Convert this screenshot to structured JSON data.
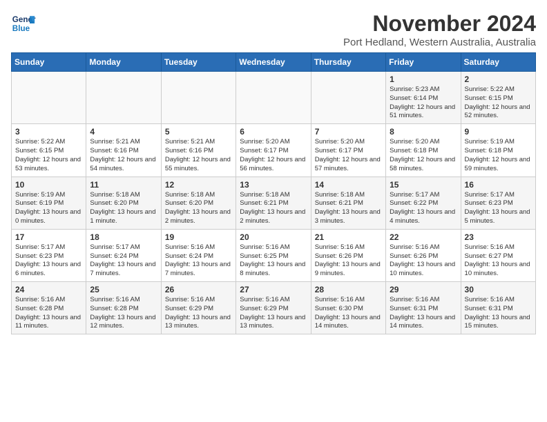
{
  "logo": {
    "line1": "General",
    "line2": "Blue"
  },
  "title": "November 2024",
  "subtitle": "Port Hedland, Western Australia, Australia",
  "days_of_week": [
    "Sunday",
    "Monday",
    "Tuesday",
    "Wednesday",
    "Thursday",
    "Friday",
    "Saturday"
  ],
  "weeks": [
    [
      {
        "day": "",
        "info": ""
      },
      {
        "day": "",
        "info": ""
      },
      {
        "day": "",
        "info": ""
      },
      {
        "day": "",
        "info": ""
      },
      {
        "day": "",
        "info": ""
      },
      {
        "day": "1",
        "info": "Sunrise: 5:23 AM\nSunset: 6:14 PM\nDaylight: 12 hours and 51 minutes."
      },
      {
        "day": "2",
        "info": "Sunrise: 5:22 AM\nSunset: 6:15 PM\nDaylight: 12 hours and 52 minutes."
      }
    ],
    [
      {
        "day": "3",
        "info": "Sunrise: 5:22 AM\nSunset: 6:15 PM\nDaylight: 12 hours and 53 minutes."
      },
      {
        "day": "4",
        "info": "Sunrise: 5:21 AM\nSunset: 6:16 PM\nDaylight: 12 hours and 54 minutes."
      },
      {
        "day": "5",
        "info": "Sunrise: 5:21 AM\nSunset: 6:16 PM\nDaylight: 12 hours and 55 minutes."
      },
      {
        "day": "6",
        "info": "Sunrise: 5:20 AM\nSunset: 6:17 PM\nDaylight: 12 hours and 56 minutes."
      },
      {
        "day": "7",
        "info": "Sunrise: 5:20 AM\nSunset: 6:17 PM\nDaylight: 12 hours and 57 minutes."
      },
      {
        "day": "8",
        "info": "Sunrise: 5:20 AM\nSunset: 6:18 PM\nDaylight: 12 hours and 58 minutes."
      },
      {
        "day": "9",
        "info": "Sunrise: 5:19 AM\nSunset: 6:18 PM\nDaylight: 12 hours and 59 minutes."
      }
    ],
    [
      {
        "day": "10",
        "info": "Sunrise: 5:19 AM\nSunset: 6:19 PM\nDaylight: 13 hours and 0 minutes."
      },
      {
        "day": "11",
        "info": "Sunrise: 5:18 AM\nSunset: 6:20 PM\nDaylight: 13 hours and 1 minute."
      },
      {
        "day": "12",
        "info": "Sunrise: 5:18 AM\nSunset: 6:20 PM\nDaylight: 13 hours and 2 minutes."
      },
      {
        "day": "13",
        "info": "Sunrise: 5:18 AM\nSunset: 6:21 PM\nDaylight: 13 hours and 2 minutes."
      },
      {
        "day": "14",
        "info": "Sunrise: 5:18 AM\nSunset: 6:21 PM\nDaylight: 13 hours and 3 minutes."
      },
      {
        "day": "15",
        "info": "Sunrise: 5:17 AM\nSunset: 6:22 PM\nDaylight: 13 hours and 4 minutes."
      },
      {
        "day": "16",
        "info": "Sunrise: 5:17 AM\nSunset: 6:23 PM\nDaylight: 13 hours and 5 minutes."
      }
    ],
    [
      {
        "day": "17",
        "info": "Sunrise: 5:17 AM\nSunset: 6:23 PM\nDaylight: 13 hours and 6 minutes."
      },
      {
        "day": "18",
        "info": "Sunrise: 5:17 AM\nSunset: 6:24 PM\nDaylight: 13 hours and 7 minutes."
      },
      {
        "day": "19",
        "info": "Sunrise: 5:16 AM\nSunset: 6:24 PM\nDaylight: 13 hours and 7 minutes."
      },
      {
        "day": "20",
        "info": "Sunrise: 5:16 AM\nSunset: 6:25 PM\nDaylight: 13 hours and 8 minutes."
      },
      {
        "day": "21",
        "info": "Sunrise: 5:16 AM\nSunset: 6:26 PM\nDaylight: 13 hours and 9 minutes."
      },
      {
        "day": "22",
        "info": "Sunrise: 5:16 AM\nSunset: 6:26 PM\nDaylight: 13 hours and 10 minutes."
      },
      {
        "day": "23",
        "info": "Sunrise: 5:16 AM\nSunset: 6:27 PM\nDaylight: 13 hours and 10 minutes."
      }
    ],
    [
      {
        "day": "24",
        "info": "Sunrise: 5:16 AM\nSunset: 6:28 PM\nDaylight: 13 hours and 11 minutes."
      },
      {
        "day": "25",
        "info": "Sunrise: 5:16 AM\nSunset: 6:28 PM\nDaylight: 13 hours and 12 minutes."
      },
      {
        "day": "26",
        "info": "Sunrise: 5:16 AM\nSunset: 6:29 PM\nDaylight: 13 hours and 13 minutes."
      },
      {
        "day": "27",
        "info": "Sunrise: 5:16 AM\nSunset: 6:29 PM\nDaylight: 13 hours and 13 minutes."
      },
      {
        "day": "28",
        "info": "Sunrise: 5:16 AM\nSunset: 6:30 PM\nDaylight: 13 hours and 14 minutes."
      },
      {
        "day": "29",
        "info": "Sunrise: 5:16 AM\nSunset: 6:31 PM\nDaylight: 13 hours and 14 minutes."
      },
      {
        "day": "30",
        "info": "Sunrise: 5:16 AM\nSunset: 6:31 PM\nDaylight: 13 hours and 15 minutes."
      }
    ]
  ]
}
